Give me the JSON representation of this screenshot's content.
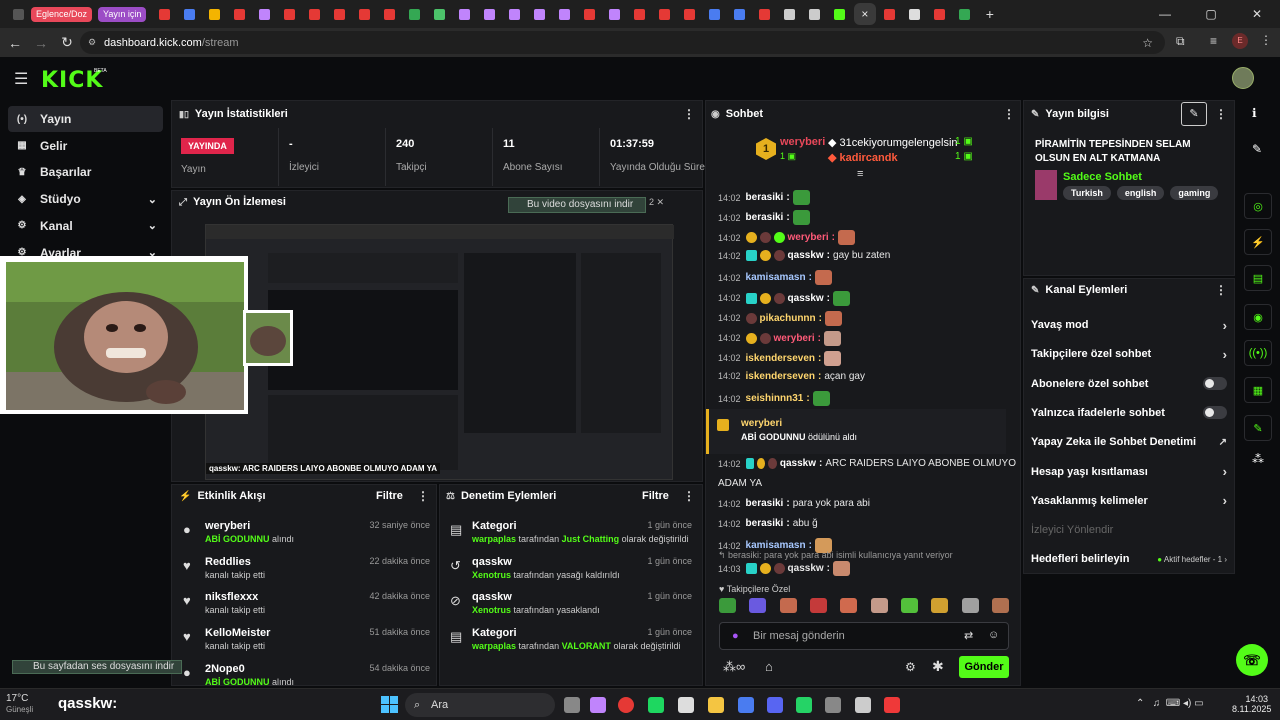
{
  "browser": {
    "groups": [
      {
        "label": "Eglence/Doz",
        "color": "#e8485a"
      },
      {
        "label": "Yayın için",
        "color": "#9c4dc6"
      }
    ],
    "url_domain": "dashboard.kick.com",
    "url_path": "/stream",
    "close": "×",
    "new_tab": "+",
    "win": [
      "—",
      "▢",
      "✕"
    ],
    "profile": "E"
  },
  "header": {
    "logo": "KICK",
    "beta": "BETA"
  },
  "sidebar": {
    "items": [
      {
        "label": "Yayın",
        "icon": "(•)"
      },
      {
        "label": "Gelir",
        "icon": "▦"
      },
      {
        "label": "Başarılar",
        "icon": "♛"
      },
      {
        "label": "Stüdyo",
        "icon": "◈"
      },
      {
        "label": "Kanal",
        "icon": "⚙"
      },
      {
        "label": "Ayarlar",
        "icon": "⚙"
      }
    ]
  },
  "stats": {
    "title": "Yayın İstatistikleri",
    "live": "YAYINDA",
    "live_label": "Yayın",
    "items": [
      {
        "value": "-",
        "label": "İzleyici"
      },
      {
        "value": "240",
        "label": "Takipçi"
      },
      {
        "value": "11",
        "label": "Abone Sayısı"
      },
      {
        "value": "01:37:59",
        "label": "Yayında Olduğu Süre"
      }
    ]
  },
  "preview": {
    "title": "Yayın Ön İzlemesi",
    "download": "Bu video dosyasını indir",
    "download_meta": "2  ✕",
    "caption": "qasskw: ARC RAIDERS LAIYO ABONBE OLMUYO ADAM YA"
  },
  "feed": {
    "title": "Etkinlik Akışı",
    "filter": "Filtre",
    "items": [
      {
        "name": "weryberi",
        "sub_green": "ABİ GODUNNU",
        "sub": "alındı",
        "time": "32 saniye önce",
        "icon": "●"
      },
      {
        "name": "Reddlies",
        "sub_green": "",
        "sub": "kanalı takip etti",
        "time": "22 dakika önce",
        "icon": "♥"
      },
      {
        "name": "niksflexxx",
        "sub_green": "",
        "sub": "kanalı takip etti",
        "time": "42 dakika önce",
        "icon": "♥"
      },
      {
        "name": "KelloMeister",
        "sub_green": "",
        "sub": "kanalı takip etti",
        "time": "51 dakika önce",
        "icon": "♥"
      },
      {
        "name": "2Nope0",
        "sub_green": "ABİ GODUNNU",
        "sub": "alındı",
        "time": "54 dakika önce",
        "icon": "●"
      }
    ]
  },
  "moderation": {
    "title": "Denetim Eylemleri",
    "filter": "Filtre",
    "items": [
      {
        "name": "Kategori",
        "g1": "warpaplas",
        "mid": "tarafından",
        "g2": "Just Chatting",
        "end": "olarak değiştirildi",
        "time": "1 gün önce",
        "icon": "▤"
      },
      {
        "name": "qasskw",
        "g1": "Xenotrus",
        "mid": "tarafından yasağı kaldırıldı",
        "g2": "",
        "end": "",
        "time": "1 gün önce",
        "icon": "↺"
      },
      {
        "name": "qasskw",
        "g1": "Xenotrus",
        "mid": "tarafından yasaklandı",
        "g2": "",
        "end": "",
        "time": "1 gün önce",
        "icon": "⊘"
      },
      {
        "name": "Kategori",
        "g1": "warpaplas",
        "mid": "tarafından",
        "g2": "VALORANT",
        "end": "olarak değiştirildi",
        "time": "1 gün önce",
        "icon": "▤"
      }
    ]
  },
  "chat": {
    "title": "Sohbet",
    "top": [
      {
        "name": "weryberi",
        "count": "1",
        "color": "#e8485a"
      },
      {
        "name": "31cekiyorumgelengelsin",
        "count": "1",
        "color": "#ffffff"
      },
      {
        "name": "kadircandk",
        "count": "1",
        "color": "#ff5a3c"
      }
    ],
    "rank": "1",
    "messages": [
      {
        "time": "14:02",
        "user": "berasiki",
        "color": "#ffffff",
        "text": ""
      },
      {
        "time": "14:02",
        "user": "berasiki",
        "color": "#ffffff",
        "text": ""
      },
      {
        "time": "14:02",
        "user": "weryberi",
        "color": "#ff5a78",
        "text": ""
      },
      {
        "time": "14:02",
        "user": "qasskw",
        "color": "#ffffff",
        "text": "gay bu zaten"
      },
      {
        "time": "14:02",
        "user": "kamisamasn",
        "color": "#a7c8ff",
        "text": ""
      },
      {
        "time": "14:02",
        "user": "qasskw",
        "color": "#ffffff",
        "text": ""
      },
      {
        "time": "14:02",
        "user": "pikachunnn",
        "color": "#ffd66e",
        "text": ""
      },
      {
        "time": "14:02",
        "user": "weryberi",
        "color": "#ff5a78",
        "text": ""
      },
      {
        "time": "14:02",
        "user": "iskenderseven",
        "color": "#ffd66e",
        "text": ""
      },
      {
        "time": "14:02",
        "user": "iskenderseven",
        "color": "#ffd66e",
        "text": "açan gay"
      },
      {
        "time": "14:02",
        "user": "seishinnn31",
        "color": "#ffd66e",
        "text": ""
      }
    ],
    "redeem_user": "weryberi",
    "redeem_text": "ABİ GODUNNU",
    "redeem_suffix": "ödülünü aldı",
    "messages2": [
      {
        "time": "14:02",
        "user": "qasskw",
        "color": "#ffffff",
        "text": "ARC RAIDERS LAIYO ABONBE OLMUYO"
      },
      {
        "time": "",
        "user": "",
        "color": "#ffffff",
        "text": "ADAM YA"
      },
      {
        "time": "14:02",
        "user": "berasiki",
        "color": "#ffffff",
        "text": "para yok para abi"
      },
      {
        "time": "14:02",
        "user": "berasiki",
        "color": "#ffffff",
        "text": "abu ğ"
      },
      {
        "time": "14:02",
        "user": "kamisamasn",
        "color": "#a7c8ff",
        "text": ""
      }
    ],
    "reply": "berasiki: para yok para abi isimli kullanıcıya yanıt veriyor",
    "last": {
      "time": "14:03",
      "user": "qasskw",
      "color": "#ffffff"
    },
    "followers_only": "Takipçilere Özel",
    "input_placeholder": "Bir mesaj gönderin",
    "send": "Gönder"
  },
  "info": {
    "title": "Yayın bilgisi",
    "stream_title": "PİRAMİTİN TEPESİNDEN SELAM OLSUN EN ALT KATMANA",
    "category": "Sadece Sohbet",
    "tags": [
      "Turkish",
      "english",
      "gaming"
    ]
  },
  "actions": {
    "title": "Kanal Eylemleri",
    "items": [
      {
        "label": "Yavaş mod",
        "kind": "chev"
      },
      {
        "label": "Takipçilere özel sohbet",
        "kind": "chev"
      },
      {
        "label": "Abonelere özel sohbet",
        "kind": "toggle"
      },
      {
        "label": "Yalnızca ifadelerle sohbet",
        "kind": "toggle"
      },
      {
        "label": "Yapay Zeka ile Sohbet Denetimi",
        "kind": "ext"
      },
      {
        "label": "Hesap yaşı kısıtlaması",
        "kind": "chev"
      },
      {
        "label": "Yasaklanmış kelimeler",
        "kind": "chev"
      },
      {
        "label": "İzleyici Yönlendir",
        "kind": "disabled"
      },
      {
        "label": "Hedefleri belirleyin",
        "kind": "goal"
      }
    ],
    "goal_status": "Aktif hedefler - 1"
  },
  "overlay": {
    "download_bottom": "Bu sayfadan ses dosyasını indir",
    "chat_user": "qasskw:"
  },
  "taskbar": {
    "search": "Ara",
    "time": "14:03",
    "date": "8.11.2025",
    "weather": "17°C",
    "weather2": "Güneşli"
  }
}
